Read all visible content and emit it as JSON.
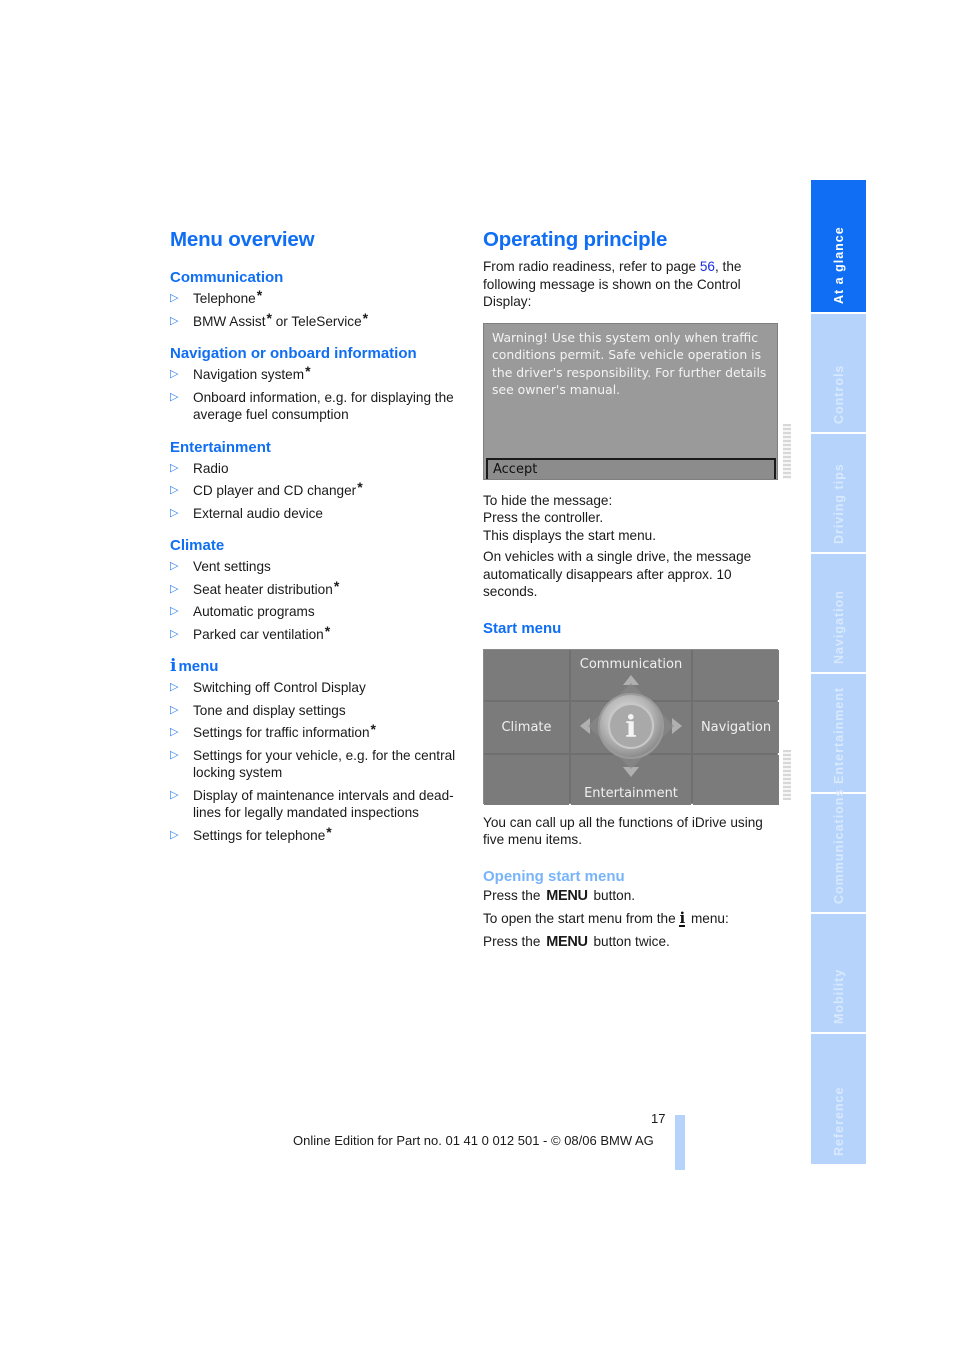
{
  "left": {
    "title": "Menu overview",
    "sections": [
      {
        "heading": "Communication",
        "items": [
          {
            "text": "Telephone",
            "star": true
          },
          {
            "text": "BMW Assist",
            "star": true,
            "suffix": " or TeleService",
            "suffix_star": true
          }
        ]
      },
      {
        "heading": "Navigation or onboard information",
        "items": [
          {
            "text": "Navigation system",
            "star": true
          },
          {
            "text": "Onboard information, e.g. for displaying the average fuel consumption",
            "star": false
          }
        ]
      },
      {
        "heading": "Entertainment",
        "items": [
          {
            "text": "Radio",
            "star": false
          },
          {
            "text": "CD player and CD changer",
            "star": true
          },
          {
            "text": "External audio device",
            "star": false
          }
        ]
      },
      {
        "heading": "Climate",
        "items": [
          {
            "text": "Vent settings",
            "star": false
          },
          {
            "text": "Seat heater distribution",
            "star": true
          },
          {
            "text": "Automatic programs",
            "star": false
          },
          {
            "text": "Parked car ventilation",
            "star": true
          }
        ]
      },
      {
        "heading": "menu",
        "heading_icon": "i-info-icon",
        "items": [
          {
            "text": "Switching off Control Display",
            "star": false
          },
          {
            "text": "Tone and display settings",
            "star": false
          },
          {
            "text": "Settings for traffic information",
            "star": true
          },
          {
            "text": "Settings for your vehicle, e.g. for the central locking system",
            "star": false
          },
          {
            "text": "Display of maintenance intervals and dead-lines for legally mandated inspections",
            "star": false
          },
          {
            "text": "Settings for telephone",
            "star": true
          }
        ]
      }
    ],
    "bullet_glyph": "▷",
    "star_glyph": "*"
  },
  "right": {
    "title": "Operating principle",
    "intro_before": "From radio readiness, refer to page ",
    "intro_link": "56",
    "intro_after": ", the following message is shown on the Control Display:",
    "warning_screen": {
      "message": "Warning! Use this system only when traffic conditions permit. Safe vehicle operation is the driver's responsibility. For further details see owner's manual.",
      "button": "Accept"
    },
    "hide_lines": [
      "To hide the message:",
      "Press the controller.",
      "This displays the start menu."
    ],
    "single_drive": "On vehicles with a single drive, the message automatically disappears after approx. 10 seconds.",
    "start_menu_heading": "Start menu",
    "start_menu": {
      "top": "Communication",
      "left": "Climate",
      "right": "Navigation",
      "bottom": "Entertainment",
      "center_icon": "i-info-icon"
    },
    "idrive_text": "You can call up all the functions of iDrive using five menu items.",
    "opening_heading": "Opening start menu",
    "press_menu_before": "Press the ",
    "menu_key": "MENU",
    "press_menu_after": " button.",
    "from_i_before": "To open the start menu from the ",
    "from_i_after": " menu:",
    "press_twice_before": "Press the ",
    "press_twice_after": " button twice."
  },
  "tabs": [
    {
      "label": "At a glance",
      "active": true
    },
    {
      "label": "Controls",
      "active": false
    },
    {
      "label": "Driving tips",
      "active": false
    },
    {
      "label": "Navigation",
      "active": false
    },
    {
      "label": "Entertainment",
      "active": false
    },
    {
      "label": "Communications",
      "active": false
    },
    {
      "label": "Mobility",
      "active": false
    },
    {
      "label": "Reference",
      "active": false
    }
  ],
  "footer": {
    "page_number": "17",
    "edition": "Online Edition for Part no. 01 41 0 012 501 - © 08/06 BMW AG"
  },
  "colors": {
    "accent": "#0f6ef3",
    "accent_light": "#78b4fa",
    "tab_inactive": "#b5d3fb",
    "link": "#1a2ee0"
  }
}
